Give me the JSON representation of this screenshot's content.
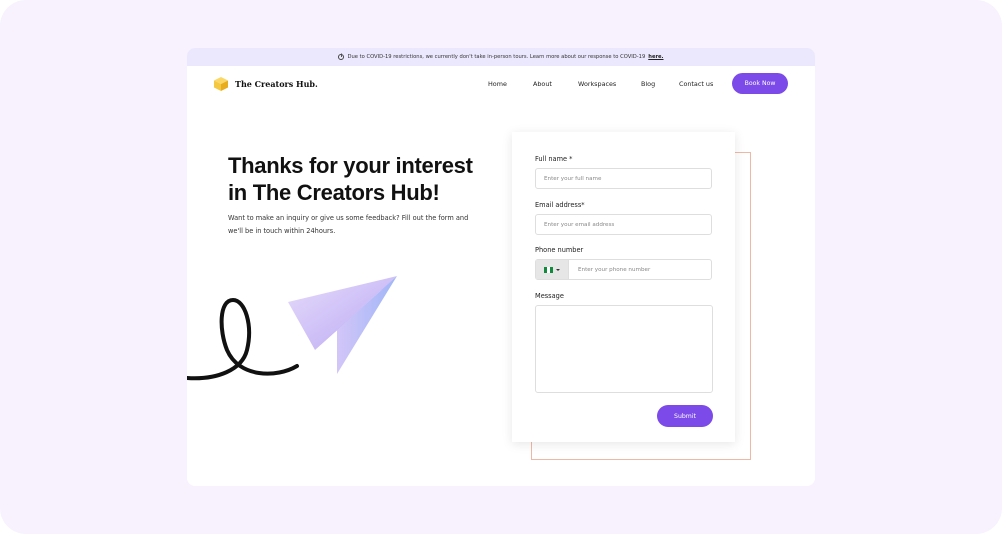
{
  "banner": {
    "text": "Due to COVID-19 restrictions, we currently don't take in-person tours. Learn more about our response to COVID-19",
    "link": "here."
  },
  "brand": {
    "name": "The Creators Hub.",
    "logo_icon": "cube-icon",
    "logo_color": "#f5c842"
  },
  "nav": {
    "items": [
      "Home",
      "About",
      "Workspaces",
      "Blog",
      "Contact us"
    ],
    "cta": "Book Now"
  },
  "hero": {
    "headline": "Thanks for your interest in The Creators Hub!",
    "subtext": "Want to make an inquiry or give us some feedback? Fill out the form and we'll be in touch within 24hours."
  },
  "form": {
    "full_name": {
      "label": "Full name *",
      "placeholder": "Enter your full name"
    },
    "email": {
      "label": "Email address*",
      "placeholder": "Enter your email address"
    },
    "phone": {
      "label": "Phone number",
      "placeholder": "Enter your phone number",
      "country_flag": "nigeria-flag-icon"
    },
    "message": {
      "label": "Message",
      "value": ""
    },
    "submit": "Submit"
  },
  "colors": {
    "accent": "#7b4ae8",
    "page_bg": "#f8f1fe",
    "banner_bg": "#ebe8fd",
    "form_outline": "#f1b7a6"
  }
}
